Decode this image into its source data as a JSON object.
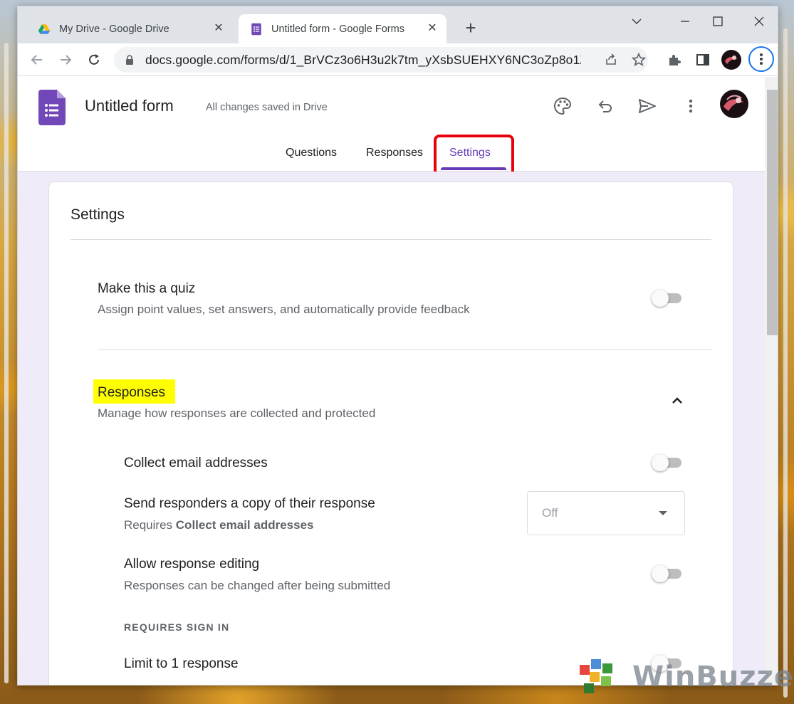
{
  "browser": {
    "tabs": [
      {
        "title": "My Drive - Google Drive",
        "icon": "google-drive-icon"
      },
      {
        "title": "Untitled form - Google Forms",
        "icon": "google-forms-icon",
        "active": true
      }
    ],
    "url": "docs.google.com/forms/d/1_BrVCz3o6H3u2k7tm_yXsbSUEHXY6NC3oZp8o1Zm..."
  },
  "form_header": {
    "title": "Untitled form",
    "save_status": "All changes saved in Drive",
    "tabs": [
      "Questions",
      "Responses",
      "Settings"
    ],
    "active_tab": "Settings",
    "accent_color": "#673ab7"
  },
  "settings": {
    "heading": "Settings",
    "quiz": {
      "title": "Make this a quiz",
      "description": "Assign point values, set answers, and automatically provide feedback",
      "enabled": false
    },
    "responses": {
      "title": "Responses",
      "description": "Manage how responses are collected and protected",
      "expanded": true,
      "collect_email": {
        "title": "Collect email addresses",
        "enabled": false
      },
      "send_copy": {
        "title": "Send responders a copy of their response",
        "requires_prefix": "Requires",
        "requires_bold": "Collect email addresses",
        "value": "Off"
      },
      "allow_editing": {
        "title": "Allow response editing",
        "description": "Responses can be changed after being submitted",
        "enabled": false
      },
      "sign_in_heading": "REQUIRES SIGN IN",
      "limit_one": {
        "title": "Limit to 1 response",
        "enabled": false
      }
    }
  },
  "watermark": {
    "text": "WinBuzzer"
  }
}
